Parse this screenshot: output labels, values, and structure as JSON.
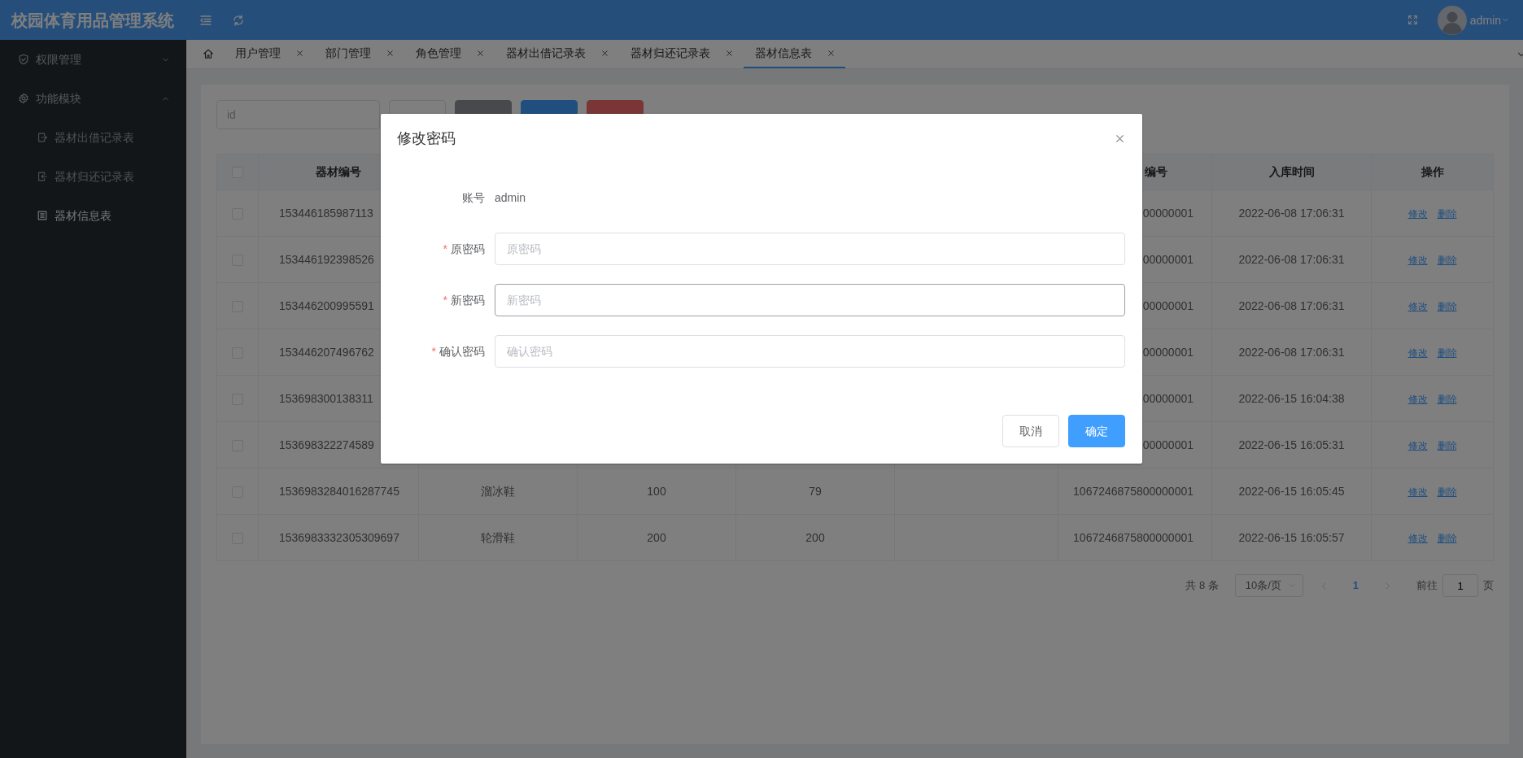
{
  "header": {
    "title": "校园体育用品管理系统",
    "user": "admin"
  },
  "sidebar": {
    "items": [
      {
        "label": "权限管理",
        "expanded": false
      },
      {
        "label": "功能模块",
        "expanded": true,
        "children": [
          {
            "label": "器材出借记录表",
            "selected": false
          },
          {
            "label": "器材归还记录表",
            "selected": false
          },
          {
            "label": "器材信息表",
            "selected": true
          }
        ]
      }
    ]
  },
  "tabs": [
    {
      "label": "用户管理",
      "selected": false
    },
    {
      "label": "部门管理",
      "selected": false
    },
    {
      "label": "角色管理",
      "selected": false
    },
    {
      "label": "器材出借记录表",
      "selected": false
    },
    {
      "label": "器材归还记录表",
      "selected": false
    },
    {
      "label": "器材信息表",
      "selected": true
    }
  ],
  "toolbar": {
    "search": {
      "placeholder": "id"
    },
    "buttons": [
      {
        "kind": "default"
      },
      {
        "kind": "secondary"
      },
      {
        "kind": "primary"
      },
      {
        "kind": "danger"
      }
    ]
  },
  "table": {
    "select_all": {
      "checked": false
    },
    "headers": {
      "column_1": "器材编号",
      "column_6": "编号",
      "column_7": "入库时间",
      "column_8": "操作"
    },
    "rows": [
      {
        "checked": false,
        "column_1": "153446185987113",
        "column_6": "00000001",
        "column_7": "2022-06-08 17:06:31",
        "actions": [
          "修改",
          "删除"
        ]
      },
      {
        "checked": false,
        "column_1": "153446192398526",
        "column_6": "00000001",
        "column_7": "2022-06-08 17:06:31",
        "actions": [
          "修改",
          "删除"
        ]
      },
      {
        "checked": false,
        "column_1": "153446200995591",
        "column_6": "00000001",
        "column_7": "2022-06-08 17:06:31",
        "actions": [
          "修改",
          "删除"
        ]
      },
      {
        "checked": false,
        "column_1": "153446207496762",
        "column_6": "00000001",
        "column_7": "2022-06-08 17:06:31",
        "actions": [
          "修改",
          "删除"
        ]
      },
      {
        "checked": false,
        "column_1": "153698300138311",
        "column_6": "00000001",
        "column_7": "2022-06-15 16:04:38",
        "actions": [
          "修改",
          "删除"
        ]
      },
      {
        "checked": false,
        "column_1": "153698322274589",
        "column_6": "00000001",
        "column_7": "2022-06-15 16:05:31",
        "actions": [
          "修改",
          "删除"
        ]
      },
      {
        "checked": false,
        "column_1": "1536983284016287745",
        "column_2": "溜冰鞋",
        "column_3": "100",
        "column_4": "79",
        "column_6": "1067246875800000001",
        "column_7": "2022-06-15 16:05:45",
        "actions": [
          "修改",
          "删除"
        ]
      },
      {
        "checked": false,
        "column_1": "1536983332305309697",
        "column_2": "轮滑鞋",
        "column_3": "200",
        "column_4": "200",
        "column_6": "1067246875800000001",
        "column_7": "2022-06-15 16:05:57",
        "actions": [
          "修改",
          "删除"
        ]
      }
    ]
  },
  "pagination": {
    "total": "共 8 条",
    "page_size": "10条/页",
    "pages": [
      {
        "label": "1",
        "selected": true
      }
    ],
    "jump_label": "前往",
    "jump_value": "1",
    "jump_suffix": "页"
  },
  "dialog": {
    "title": "修改密码",
    "account_label": "账号",
    "account_value": "admin",
    "fields": [
      {
        "label": "原密码",
        "required_mark": "*",
        "placeholder": "原密码",
        "focused": false
      },
      {
        "label": "新密码",
        "required_mark": "*",
        "placeholder": "新密码",
        "focused": true
      },
      {
        "label": "确认密码",
        "required_mark": "*",
        "placeholder": "确认密码",
        "focused": false
      }
    ],
    "buttons": [
      {
        "label": "取消",
        "kind": "default"
      },
      {
        "label": "确定",
        "kind": "primary"
      }
    ]
  }
}
